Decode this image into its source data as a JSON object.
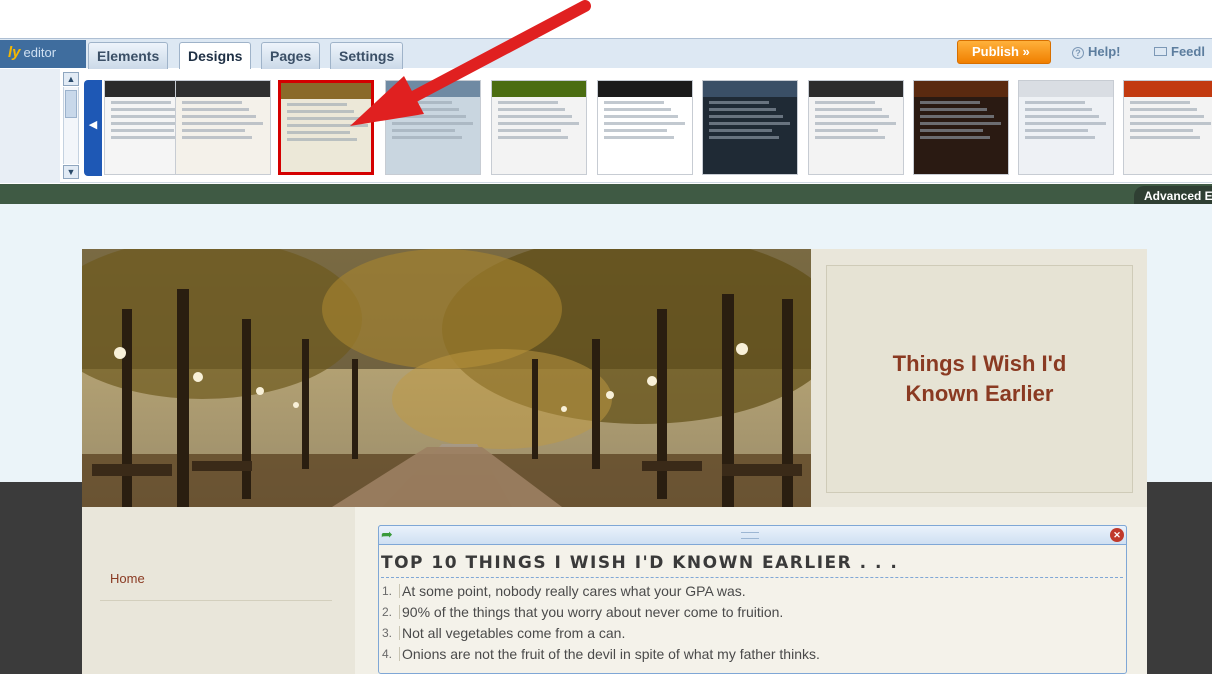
{
  "editor": {
    "logo_mark": "ly",
    "logo_text": "editor",
    "tabs": [
      "Elements",
      "Designs",
      "Pages",
      "Settings"
    ],
    "active_tab": "Designs",
    "publish_label": "Publish »",
    "help_label": "Help!",
    "feedback_label": "Feedl",
    "advanced_label": "Advanced Ed"
  },
  "design_strip": {
    "thumbnails": [
      {
        "name": "design-thumb-1",
        "head": "#2b2b2b",
        "body": "#f5f5f5"
      },
      {
        "name": "design-thumb-2",
        "head": "#2f2f2f",
        "body": "#f4f1ea"
      },
      {
        "name": "design-thumb-3",
        "head": "#8a6a2a",
        "body": "#ece8d8",
        "selected": true
      },
      {
        "name": "design-thumb-4",
        "head": "#6f8aa3",
        "body": "#c9d6e0"
      },
      {
        "name": "design-thumb-5",
        "head": "#4b6d12",
        "body": "#f3f3f3"
      },
      {
        "name": "design-thumb-6",
        "head": "#1b1b1b",
        "body": "#ffffff"
      },
      {
        "name": "design-thumb-7",
        "head": "#3a4f66",
        "body": "#1f2a35"
      },
      {
        "name": "design-thumb-8",
        "head": "#2c2c2c",
        "body": "#f3f3f3"
      },
      {
        "name": "design-thumb-9",
        "head": "#5a2a10",
        "body": "#2a1a12"
      },
      {
        "name": "design-thumb-10",
        "head": "#d9dde3",
        "body": "#eef1f5"
      },
      {
        "name": "design-thumb-11",
        "head": "#c23a10",
        "body": "#f3f3f3"
      }
    ]
  },
  "site": {
    "title": "Things I Wish I'd Known Earlier",
    "nav": [
      "Home"
    ],
    "heading": "TOP 10 THINGS I WISH I'D KNOWN EARLIER . . .",
    "items": [
      {
        "num": "1.",
        "text": "At some point, nobody really cares what your GPA was."
      },
      {
        "num": "2.",
        "text": "90% of the things that you worry about never come to fruition."
      },
      {
        "num": "3.",
        "text": "Not all vegetables come from a can."
      },
      {
        "num": "4.",
        "text": "Onions are not the fruit of the devil in spite of what my father thinks."
      }
    ]
  },
  "colors": {
    "accent_red": "#e02020",
    "title_brown": "#8a3a22",
    "publish_orange": "#f07f00",
    "selection_red": "#d40000"
  }
}
